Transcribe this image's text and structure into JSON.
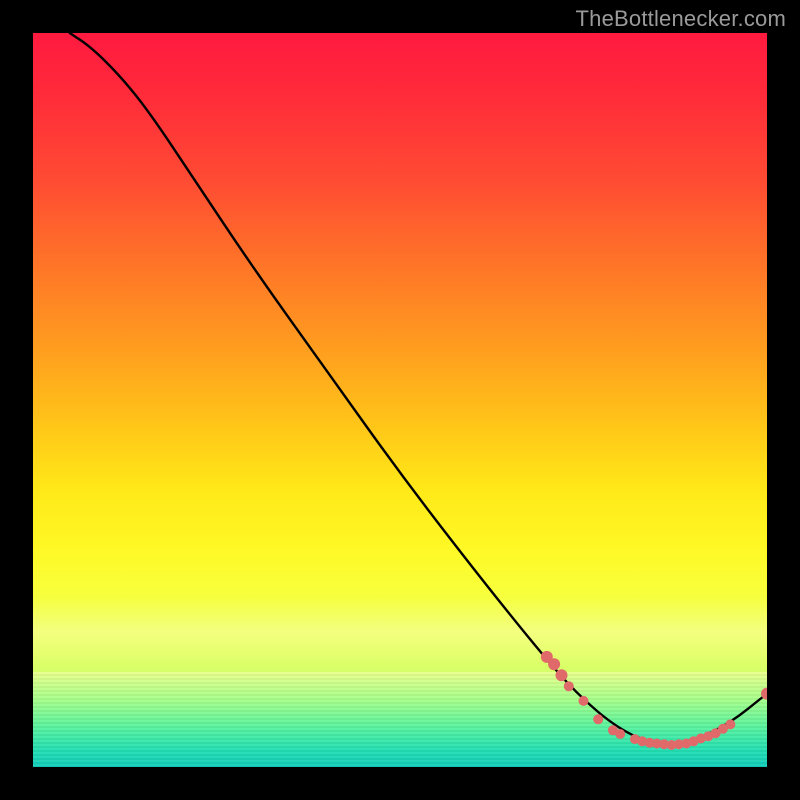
{
  "watermark": "TheBottleneсker.com",
  "chart_data": {
    "type": "line",
    "title": "",
    "xlabel": "",
    "ylabel": "",
    "xlim": [
      0,
      100
    ],
    "ylim": [
      0,
      100
    ],
    "curve": [
      {
        "x": 5,
        "y": 100
      },
      {
        "x": 8,
        "y": 98
      },
      {
        "x": 12,
        "y": 94
      },
      {
        "x": 16,
        "y": 89
      },
      {
        "x": 22,
        "y": 80
      },
      {
        "x": 30,
        "y": 68
      },
      {
        "x": 40,
        "y": 54
      },
      {
        "x": 50,
        "y": 40
      },
      {
        "x": 60,
        "y": 27
      },
      {
        "x": 68,
        "y": 17
      },
      {
        "x": 74,
        "y": 10
      },
      {
        "x": 80,
        "y": 5
      },
      {
        "x": 85,
        "y": 3
      },
      {
        "x": 90,
        "y": 3.5
      },
      {
        "x": 95,
        "y": 6
      },
      {
        "x": 100,
        "y": 10
      }
    ],
    "markers": [
      {
        "x": 70,
        "y": 15,
        "r": 6
      },
      {
        "x": 71,
        "y": 14,
        "r": 6
      },
      {
        "x": 72,
        "y": 12.5,
        "r": 6
      },
      {
        "x": 73,
        "y": 11,
        "r": 5
      },
      {
        "x": 75,
        "y": 9,
        "r": 5
      },
      {
        "x": 77,
        "y": 6.5,
        "r": 5
      },
      {
        "x": 79,
        "y": 5,
        "r": 5
      },
      {
        "x": 80,
        "y": 4.5,
        "r": 5
      },
      {
        "x": 82,
        "y": 3.8,
        "r": 5
      },
      {
        "x": 83,
        "y": 3.5,
        "r": 5
      },
      {
        "x": 84,
        "y": 3.3,
        "r": 5
      },
      {
        "x": 85,
        "y": 3.2,
        "r": 5
      },
      {
        "x": 86,
        "y": 3.1,
        "r": 5
      },
      {
        "x": 87,
        "y": 3.0,
        "r": 5
      },
      {
        "x": 88,
        "y": 3.1,
        "r": 5
      },
      {
        "x": 89,
        "y": 3.2,
        "r": 5
      },
      {
        "x": 90,
        "y": 3.5,
        "r": 5
      },
      {
        "x": 91,
        "y": 3.9,
        "r": 5
      },
      {
        "x": 92,
        "y": 4.2,
        "r": 5
      },
      {
        "x": 93,
        "y": 4.6,
        "r": 5
      },
      {
        "x": 94,
        "y": 5.2,
        "r": 5
      },
      {
        "x": 95,
        "y": 5.8,
        "r": 5
      },
      {
        "x": 100,
        "y": 10,
        "r": 6
      }
    ],
    "marker_color": "#e06a6a",
    "curve_color": "#000000"
  }
}
